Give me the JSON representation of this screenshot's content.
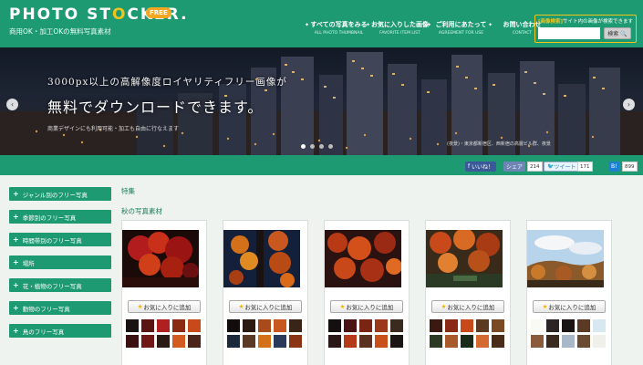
{
  "header": {
    "logo_title_a": "PHOTO ST",
    "logo_title_b": "CKER.",
    "logo_badge": "FREE",
    "logo_subtitle": "商用OK・加工OKの無料写真素材",
    "nav": [
      {
        "label": "すべての写真をみる",
        "sub": "ALL PHOTO THUMBNAIL"
      },
      {
        "label": "お気に入りした画像",
        "sub": "FAVORITE ITEM LIST"
      },
      {
        "label": "ご利用にあたって",
        "sub": "AGREEMENT FOR USE"
      },
      {
        "label": "お問い合わせ",
        "sub": "CONTACT"
      }
    ],
    "search": {
      "tag": "[画像検索]",
      "label": "サイト内の画像が検索できます",
      "placeholder": "",
      "button": "検索 🔍"
    }
  },
  "hero": {
    "line1": "3000px以上の高解像度ロイヤリティフリー画像が",
    "line2": "無料でダウンロードできます。",
    "note": "商業デザインにも利用可能・加工も自由に行なえます",
    "note_right": "(夜景)・東京都新宿区、西新宿の高層ビル群、夜景",
    "slides": 4,
    "active_slide": 1
  },
  "social": {
    "like": "いいね！",
    "share": "シェア",
    "share_count": "214",
    "tweet": "ツイート",
    "tweet_count": "171",
    "hatena": "B!",
    "hatena_count": "899"
  },
  "sidebar": {
    "items": [
      {
        "label": "ジャンル別のフリー写真"
      },
      {
        "label": "季節別のフリー写真"
      },
      {
        "label": "時間帯別のフリー写真"
      },
      {
        "label": "場所"
      },
      {
        "label": "花・植物のフリー写真"
      },
      {
        "label": "動物のフリー写真"
      },
      {
        "label": "鳥のフリー写真"
      }
    ]
  },
  "main": {
    "section": "特集",
    "subsection": "秋の写真素材",
    "fav_label": "お気に入りに追加",
    "cards": [
      {
        "swatches": [
          "#1a1212",
          "#5a1414",
          "#b02020",
          "#8a2a12",
          "#c84a1a",
          "#3a1010",
          "#701818",
          "#2a1a14",
          "#d45a20",
          "#4a2418"
        ]
      },
      {
        "swatches": [
          "#120c0c",
          "#2a1a12",
          "#a84a1a",
          "#c85820",
          "#3a2418",
          "#1a2a3a",
          "#5a3a24",
          "#d4701a",
          "#2a3a5a",
          "#8a3414"
        ]
      },
      {
        "swatches": [
          "#141010",
          "#4a1414",
          "#7a2414",
          "#9a3a1a",
          "#3a2a20",
          "#2a1818",
          "#b43a1a",
          "#5a3020",
          "#c8501a",
          "#1a1414"
        ]
      },
      {
        "swatches": [
          "#3a1a10",
          "#8a2a14",
          "#c84a1a",
          "#5a3a20",
          "#7a4a24",
          "#2a3a24",
          "#a85a2a",
          "#1a2a1a",
          "#d46a30",
          "#4a2a18"
        ]
      },
      {
        "swatches": [
          "#fafaf5",
          "#2a2424",
          "#1a1414",
          "#5a3a24",
          "#d8e8f0",
          "#8a5a3a",
          "#3a2a20",
          "#a8b8c8",
          "#6a4a30",
          "#f0f0ea"
        ]
      }
    ]
  }
}
